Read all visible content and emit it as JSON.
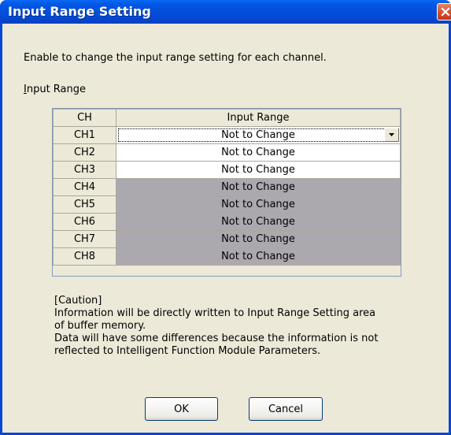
{
  "window": {
    "title": "Input Range Setting",
    "colors": {
      "titlebar": "#0350DA",
      "close": "#D34B2A",
      "face": "#ECE9D8",
      "disabled_cell": "#ACA8B0"
    }
  },
  "description": "Enable to change the input range setting for each channel.",
  "group_label": {
    "mnemonic": "I",
    "rest": "nput Range"
  },
  "grid": {
    "headers": {
      "ch": "CH",
      "range": "Input Range"
    },
    "rows": [
      {
        "ch": "CH1",
        "value": "Not to Change",
        "state": "selected-dropdown"
      },
      {
        "ch": "CH2",
        "value": "Not to Change",
        "state": "enabled"
      },
      {
        "ch": "CH3",
        "value": "Not to Change",
        "state": "enabled"
      },
      {
        "ch": "CH4",
        "value": "Not to Change",
        "state": "disabled"
      },
      {
        "ch": "CH5",
        "value": "Not to Change",
        "state": "disabled"
      },
      {
        "ch": "CH6",
        "value": "Not to Change",
        "state": "disabled"
      },
      {
        "ch": "CH7",
        "value": "Not to Change",
        "state": "disabled"
      },
      {
        "ch": "CH8",
        "value": "Not to Change",
        "state": "disabled"
      }
    ],
    "dropdown_icon": "chevron-down-icon"
  },
  "caution": {
    "heading": "[Caution]",
    "lines": [
      "Information will be directly written to Input Range Setting area",
      "of buffer memory.",
      "Data will have some differences because the information is not",
      "reflected to Intelligent Function Module Parameters."
    ]
  },
  "buttons": {
    "ok": "OK",
    "cancel": "Cancel"
  }
}
